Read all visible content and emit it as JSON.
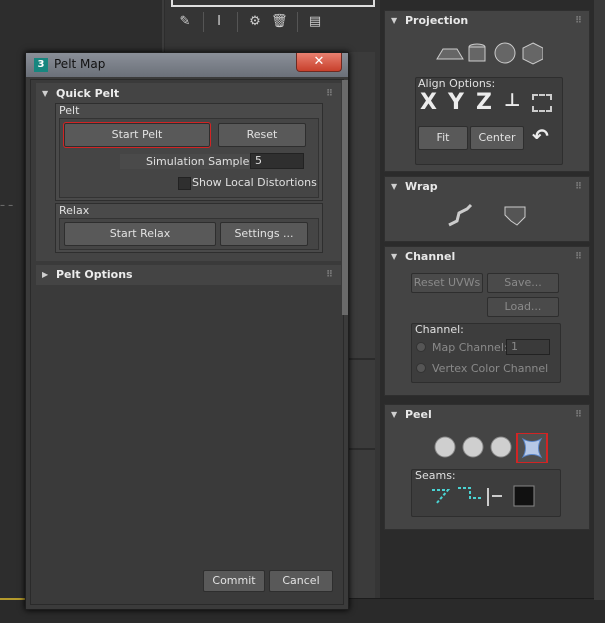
{
  "toolbar": {
    "icons": [
      "pin-icon",
      "flask-icon",
      "modifier-icon",
      "trash-icon",
      "config-icon"
    ]
  },
  "dialog": {
    "title": "Pelt Map",
    "app_icon": "3",
    "close_glyph": "✕",
    "quick_pelt": {
      "header": "Quick Pelt",
      "pelt_group": "Pelt",
      "start_pelt": "Start Pelt",
      "reset": "Reset",
      "simulation_samples_label": "Simulation Samples:",
      "simulation_samples_value": "5",
      "show_local_distortions": "Show Local Distortions",
      "relax_group": "Relax",
      "start_relax": "Start Relax",
      "settings": "Settings ..."
    },
    "pelt_options": {
      "header": "Pelt Options"
    },
    "commit": "Commit",
    "cancel": "Cancel"
  },
  "rollouts": {
    "projection": {
      "header": "Projection",
      "align_options": "Align Options:",
      "x": "X",
      "y": "Y",
      "z": "Z",
      "fit": "Fit",
      "center": "Center"
    },
    "wrap": {
      "header": "Wrap"
    },
    "channel": {
      "header": "Channel",
      "reset_uvws": "Reset UVWs",
      "save": "Save...",
      "load": "Load...",
      "channel_label": "Channel:",
      "map_channel": "Map Channel:",
      "map_channel_value": "1",
      "vertex_color_channel": "Vertex Color Channel"
    },
    "peel": {
      "header": "Peel",
      "seams": "Seams:"
    }
  },
  "colors": {
    "accent_red": "#d22424",
    "teal": "#17867f",
    "highlight_blue": "#5b86c8"
  }
}
